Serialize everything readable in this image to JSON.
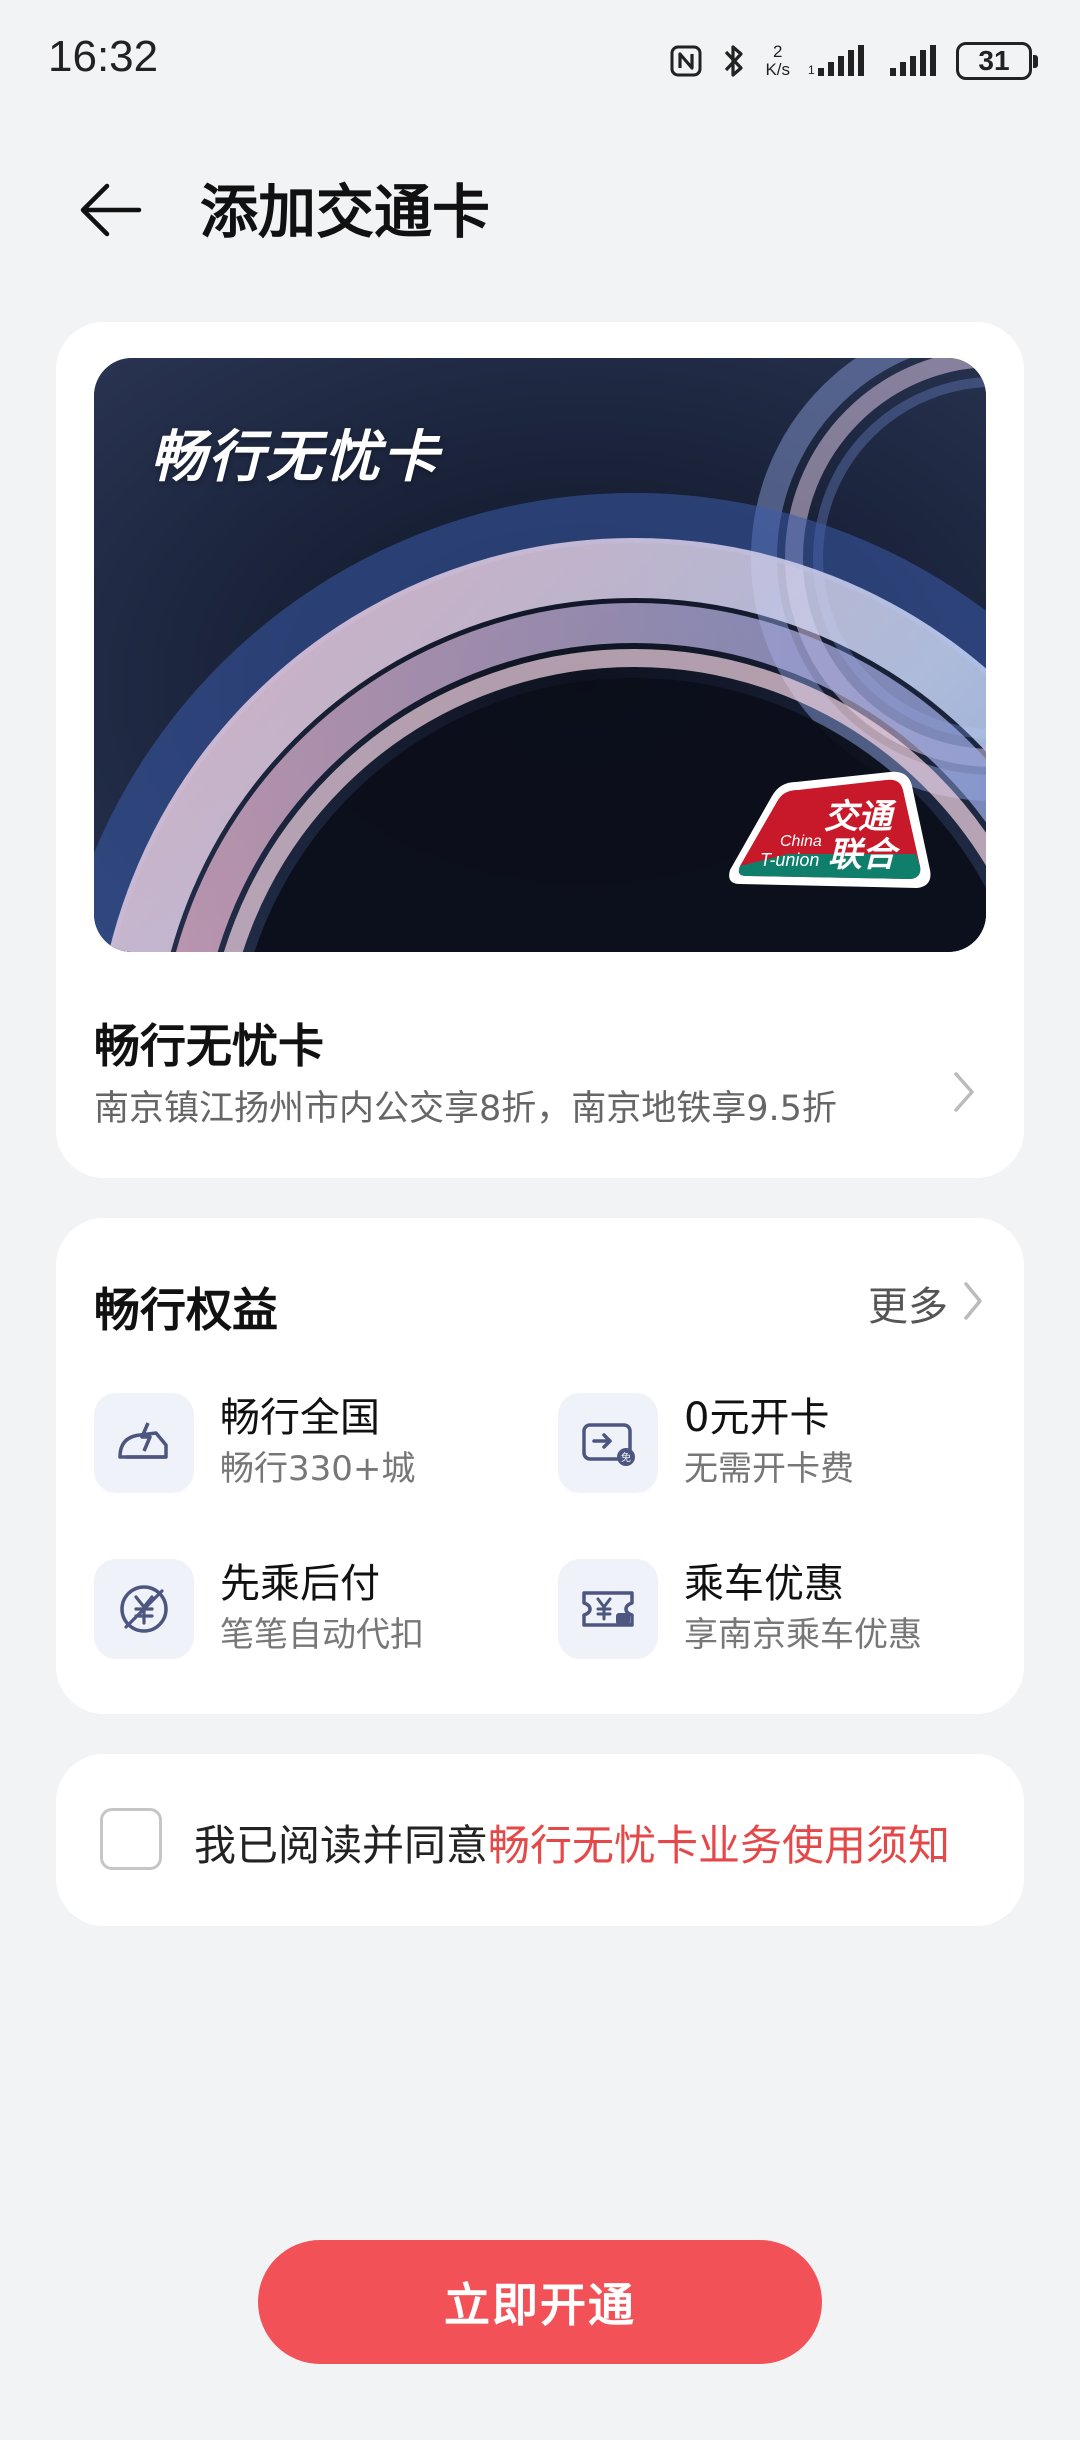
{
  "status_bar": {
    "time": "16:32",
    "net_speed_value": "2",
    "net_speed_unit": "K/s",
    "battery": "31",
    "icons": [
      "nfc-icon",
      "bluetooth-icon",
      "signal-icon-sim1",
      "signal-icon-sim2",
      "battery-icon"
    ]
  },
  "header": {
    "title": "添加交通卡",
    "back_icon": "arrow-left-icon"
  },
  "card": {
    "image_text": "畅行无忧卡",
    "logo": {
      "line1": "交通",
      "line2": "联合",
      "en_line1": "China",
      "en_line2": "T-union"
    },
    "name": "畅行无忧卡",
    "description": "南京镇江扬州市内公交享8折，南京地铁享9.5折"
  },
  "benefits": {
    "title": "畅行权益",
    "more_label": "更多",
    "items": [
      {
        "icon": "fast-travel-icon",
        "title": "畅行全国",
        "subtitle": "畅行330+城"
      },
      {
        "icon": "card-free-icon",
        "title": "0元开卡",
        "subtitle": "无需开卡费"
      },
      {
        "icon": "pay-later-icon",
        "title": "先乘后付",
        "subtitle": "笔笔自动代扣"
      },
      {
        "icon": "ride-discount-icon",
        "title": "乘车优惠",
        "subtitle": "享南京乘车优惠"
      }
    ]
  },
  "agreement": {
    "prefix": "我已阅读并同意",
    "link": "畅行无忧卡业务使用须知",
    "checked": false
  },
  "primary_button": {
    "label": "立即开通"
  },
  "colors": {
    "accent": "#f25257",
    "link": "#e54848",
    "background": "#f1f3f5",
    "icon_bg": "#f0f2f9",
    "icon_stroke": "#4d5680"
  }
}
